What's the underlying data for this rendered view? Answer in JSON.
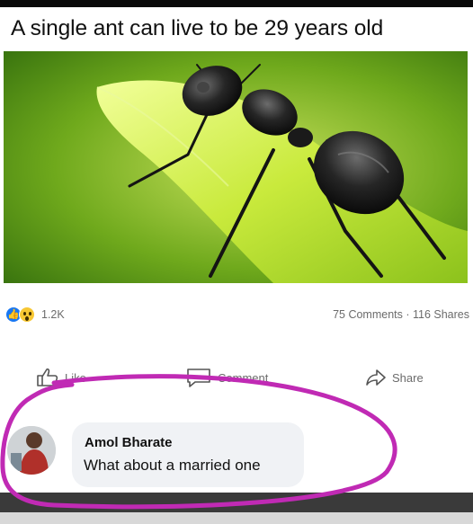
{
  "post": {
    "caption": "A single ant can live to be 29 years old"
  },
  "photo": {
    "subject": "ant-on-leaf"
  },
  "stats": {
    "reactions": [
      "like",
      "wow"
    ],
    "reaction_count": "1.2K",
    "comments_shares": "75 Comments · 116 Shares"
  },
  "actions": {
    "like_label": "Like",
    "comment_label": "Comment",
    "share_label": "Share"
  },
  "comment": {
    "author": "Amol Bharate",
    "text": "What about a married one"
  },
  "colors": {
    "highlight": "#c02ab4",
    "facebook_blue": "#1877f2",
    "leaf_green": "#9acd32"
  }
}
